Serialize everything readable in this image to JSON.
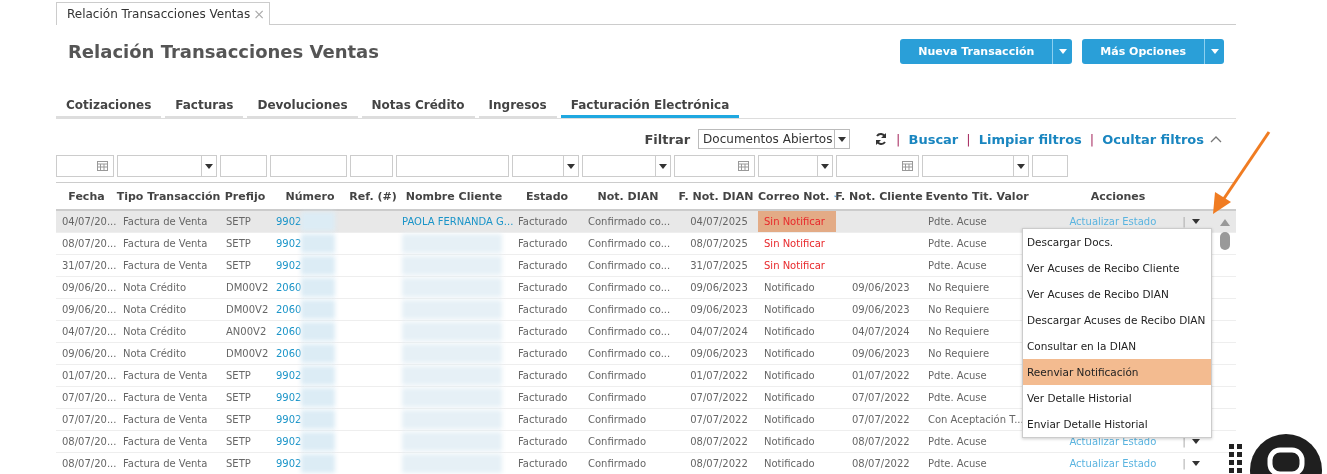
{
  "doc_tab": {
    "label": "Relación Transacciones Ventas",
    "close": "×"
  },
  "title": "Relación Transacciones Ventas",
  "buttons": [
    {
      "label": "Nueva Transacción"
    },
    {
      "label": "Más Opciones"
    }
  ],
  "tabs": [
    {
      "label": "Cotizaciones",
      "selected": false
    },
    {
      "label": "Facturas",
      "selected": false
    },
    {
      "label": "Devoluciones",
      "selected": false
    },
    {
      "label": "Notas Crédito",
      "selected": false
    },
    {
      "label": "Ingresos",
      "selected": false
    },
    {
      "label": "Facturación Electrónica",
      "selected": true
    }
  ],
  "filter_bar": {
    "label": "Filtrar",
    "select_value": "Documentos Abiertos",
    "links": [
      "Buscar",
      "Limpiar filtros",
      "Ocultar filtros"
    ],
    "separators": [
      "|",
      "|"
    ]
  },
  "filter_fields": [
    {
      "kind": "date"
    },
    {
      "kind": "select"
    },
    {
      "kind": "text"
    },
    {
      "kind": "text"
    },
    {
      "kind": "text"
    },
    {
      "kind": "text"
    },
    {
      "kind": "select"
    },
    {
      "kind": "select"
    },
    {
      "kind": "date"
    },
    {
      "kind": "select"
    },
    {
      "kind": "date"
    },
    {
      "kind": "select"
    },
    {
      "kind": "text"
    }
  ],
  "columns": [
    {
      "label": "Fecha",
      "sorted": false
    },
    {
      "label": "Tipo Transacción",
      "sorted": false
    },
    {
      "label": "Prefijo",
      "sorted": false
    },
    {
      "label": "Número",
      "sorted": false
    },
    {
      "label": "Ref. (#)",
      "sorted": false
    },
    {
      "label": "Nombre Cliente",
      "sorted": false
    },
    {
      "label": "Estado",
      "sorted": false
    },
    {
      "label": "Not. DIAN",
      "sorted": false
    },
    {
      "label": "F. Not. DIAN",
      "sorted": false
    },
    {
      "label": "Correo Not.",
      "sorted": true
    },
    {
      "label": "F. Not. Cliente",
      "sorted": false
    },
    {
      "label": "Evento Tit. Valor",
      "sorted": false
    },
    {
      "label": "Acciones",
      "sorted": false
    }
  ],
  "rows": [
    {
      "selected": true,
      "fecha": "04/07/20...",
      "tipo": "Factura de Venta",
      "prefijo": "SETP",
      "numero": "9902",
      "cliente": "PAOLA FERNANDA G...",
      "estado": "Facturado",
      "not_dian": "Confirmado co...",
      "f_not_dian": "04/07/2025",
      "correo": {
        "text": "Sin Notificar",
        "color": "#e8282b",
        "highlighted": true
      },
      "evento": "Pdte. Acuse",
      "accion": "Actualizar Estado",
      "separator": "|"
    },
    {
      "selected": false,
      "fecha": "08/07/20...",
      "tipo": "Factura de Venta",
      "prefijo": "SETP",
      "numero": "9902",
      "estado": "Facturado",
      "not_dian": "Confirmado co...",
      "f_not_dian": "08/07/2025",
      "correo": {
        "text": "Sin Notificar",
        "color": "#e8282b",
        "highlighted": false
      },
      "evento": "Pdte. Acuse"
    },
    {
      "selected": false,
      "fecha": "31/07/20...",
      "tipo": "Factura de Venta",
      "prefijo": "SETP",
      "numero": "9902",
      "estado": "Facturado",
      "not_dian": "Confirmado co...",
      "f_not_dian": "31/07/2025",
      "correo": {
        "text": "Sin Notificar",
        "color": "#e8282b",
        "highlighted": false
      },
      "evento": "Pdte. Acuse"
    },
    {
      "selected": false,
      "fecha": "09/06/20...",
      "tipo": "Nota Crédito",
      "prefijo": "DM00V2",
      "numero": "2060",
      "estado": "Facturado",
      "not_dian": "Confirmado co...",
      "f_not_dian": "09/06/2023",
      "correo": {
        "text": "Notificado",
        "color": "#666666",
        "highlighted": false
      },
      "f_not_cliente": "09/06/2023",
      "evento": "No Requiere"
    },
    {
      "selected": false,
      "fecha": "09/06/20...",
      "tipo": "Nota Crédito",
      "prefijo": "DM00V2",
      "numero": "2060",
      "estado": "Facturado",
      "not_dian": "Confirmado co...",
      "f_not_dian": "09/06/2023",
      "correo": {
        "text": "Notificado",
        "color": "#666666",
        "highlighted": false
      },
      "f_not_cliente": "09/06/2023",
      "evento": "No Requiere"
    },
    {
      "selected": false,
      "fecha": "04/07/20...",
      "tipo": "Nota Crédito",
      "prefijo": "AN00V2",
      "numero": "2060",
      "estado": "Facturado",
      "not_dian": "Confirmado co...",
      "f_not_dian": "04/07/2024",
      "correo": {
        "text": "Notificado",
        "color": "#666666",
        "highlighted": false
      },
      "f_not_cliente": "04/07/2024",
      "evento": "No Requiere"
    },
    {
      "selected": false,
      "fecha": "09/06/20...",
      "tipo": "Nota Crédito",
      "prefijo": "DM00V2",
      "numero": "2060",
      "estado": "Facturado",
      "not_dian": "Confirmado co...",
      "f_not_dian": "09/06/2023",
      "correo": {
        "text": "Notificado",
        "color": "#666666",
        "highlighted": false
      },
      "f_not_cliente": "09/06/2023",
      "evento": "No Requiere"
    },
    {
      "selected": false,
      "fecha": "01/07/20...",
      "tipo": "Factura de Venta",
      "prefijo": "SETP",
      "numero": "9902",
      "estado": "Facturado",
      "not_dian": "Confirmado",
      "f_not_dian": "01/07/2022",
      "correo": {
        "text": "Notificado",
        "color": "#666666",
        "highlighted": false
      },
      "f_not_cliente": "01/07/2022",
      "evento": "Pdte. Acuse"
    },
    {
      "selected": false,
      "fecha": "07/07/20...",
      "tipo": "Factura de Venta",
      "prefijo": "SETP",
      "numero": "9902",
      "estado": "Facturado",
      "not_dian": "Confirmado",
      "f_not_dian": "07/07/2022",
      "correo": {
        "text": "Notificado",
        "color": "#666666",
        "highlighted": false
      },
      "f_not_cliente": "07/07/2022",
      "evento": "Pdte. Acuse"
    },
    {
      "selected": false,
      "fecha": "07/07/20...",
      "tipo": "Factura de Venta",
      "prefijo": "SETP",
      "numero": "9902",
      "estado": "Facturado",
      "not_dian": "Confirmado",
      "f_not_dian": "07/07/2022",
      "correo": {
        "text": "Notificado",
        "color": "#666666",
        "highlighted": false
      },
      "f_not_cliente": "07/07/2022",
      "evento": "Con Aceptación T..."
    },
    {
      "selected": false,
      "fecha": "08/07/20...",
      "tipo": "Factura de Venta",
      "prefijo": "SETP",
      "numero": "9902",
      "estado": "Facturado",
      "not_dian": "Confirmado",
      "f_not_dian": "08/07/2022",
      "correo": {
        "text": "Notificado",
        "color": "#666666",
        "highlighted": false
      },
      "f_not_cliente": "08/07/2022",
      "evento": "Pdte. Acuse",
      "accion": "Actualizar Estado",
      "separator": "|"
    },
    {
      "selected": false,
      "fecha": "08/07/20...",
      "tipo": "Factura de Venta",
      "prefijo": "SETP",
      "numero": "9902",
      "estado": "Facturado",
      "not_dian": "Confirmado",
      "f_not_dian": "08/07/2022",
      "correo": {
        "text": "Notificado",
        "color": "#666666",
        "highlighted": false
      },
      "f_not_cliente": "08/07/2022",
      "evento": "Pdte. Acuse",
      "accion": "Actualizar Estado",
      "separator": "|"
    }
  ],
  "action_menu": [
    {
      "label": "Descargar Docs.",
      "selected": false
    },
    {
      "label": "Ver Acuses de Recibo Cliente",
      "selected": false
    },
    {
      "label": "Ver Acuses de Recibo DIAN",
      "selected": false
    },
    {
      "label": "Descargar Acuses de Recibo DIAN",
      "selected": false
    },
    {
      "label": "Consultar en la DIAN",
      "selected": false
    },
    {
      "label": "Reenviar Notificación",
      "selected": true
    },
    {
      "label": "Ver Detalle Historial",
      "selected": false
    },
    {
      "label": "Enviar Detalle Historial",
      "selected": false
    }
  ]
}
